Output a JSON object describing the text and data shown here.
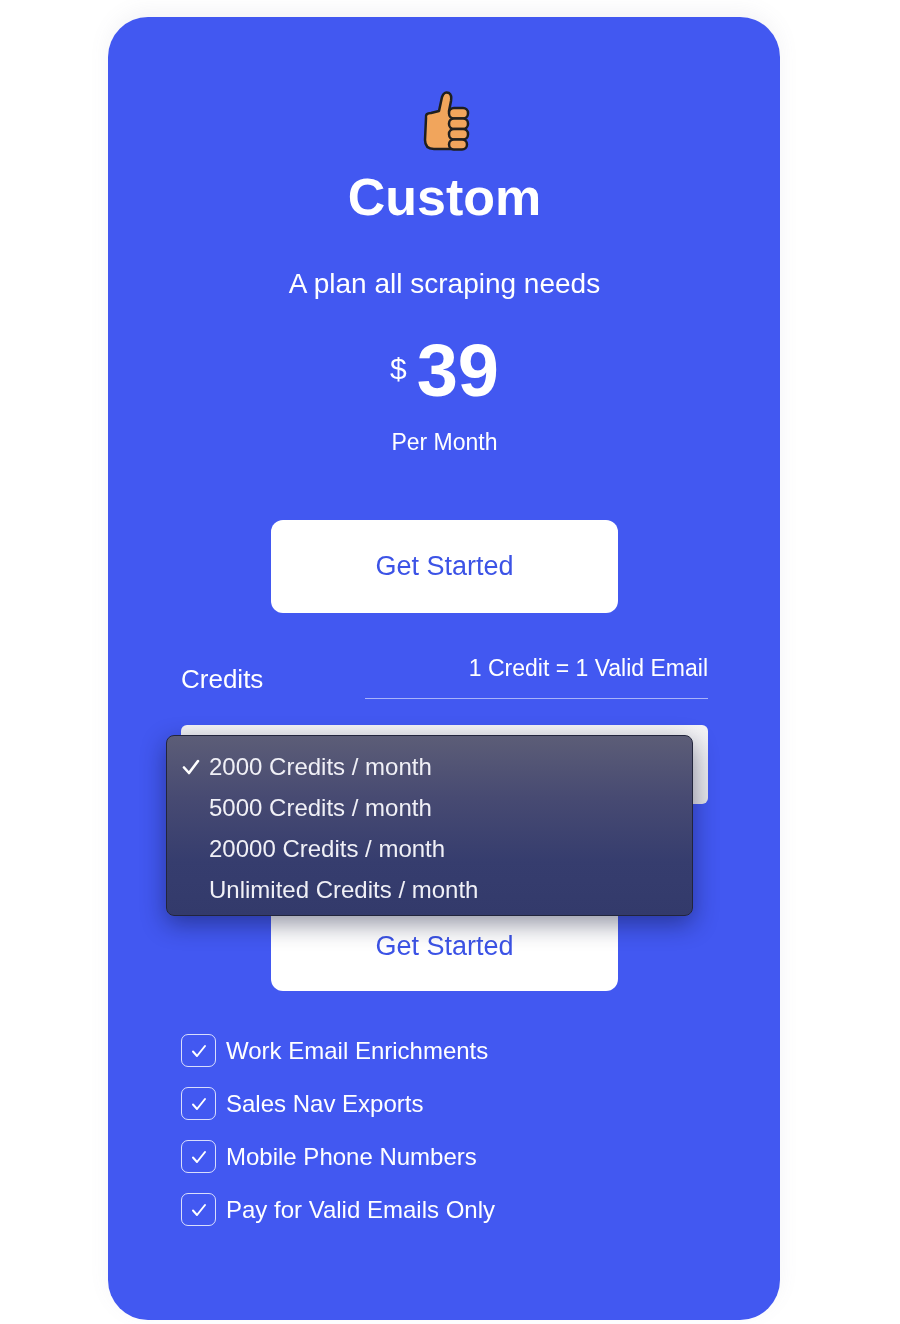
{
  "plan": {
    "name": "Custom",
    "tagline": "A plan all scraping needs",
    "currency": "$",
    "price": "39",
    "period": "Per Month"
  },
  "cta_button": "Get Started",
  "credits": {
    "label": "Credits",
    "note": "1 Credit = 1 Valid Email",
    "dropdown": {
      "expanded": true,
      "options": [
        {
          "label": "2000 Credits / month",
          "selected": true
        },
        {
          "label": "5000 Credits / month",
          "selected": false
        },
        {
          "label": "20000 Credits / month",
          "selected": false
        },
        {
          "label": "Unlimited Credits / month",
          "selected": false
        }
      ]
    }
  },
  "credits_button": "Get Started",
  "features": [
    {
      "label": "Work Email Enrichments",
      "checked": true
    },
    {
      "label": "Sales Nav Exports",
      "checked": true
    },
    {
      "label": "Mobile Phone Numbers",
      "checked": true
    },
    {
      "label": "Pay for Valid Emails Only",
      "checked": true
    }
  ]
}
